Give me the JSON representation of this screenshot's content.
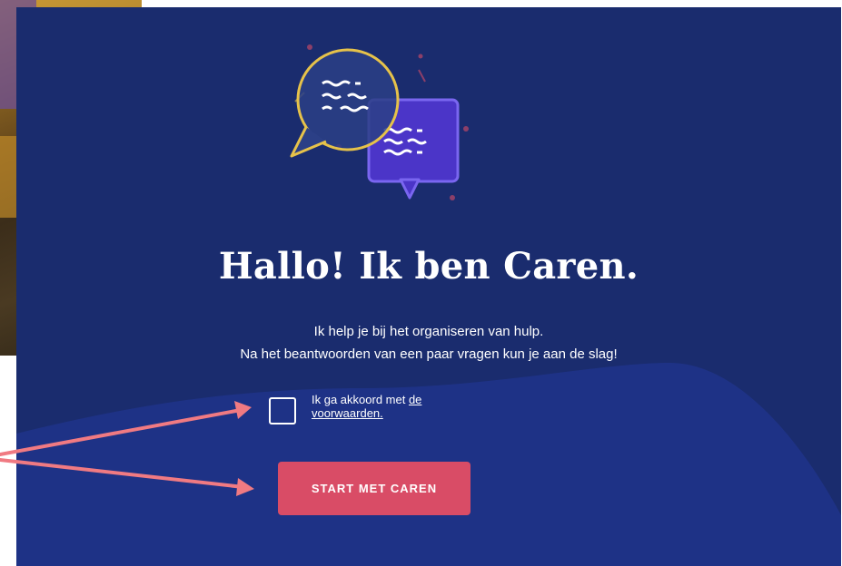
{
  "heading": "Hallo! Ik ben Caren.",
  "intro_line1": "Ik help je bij het organiseren van hulp.",
  "intro_line2": "Na het beantwoorden van een paar vragen kun je aan de slag!",
  "consent": {
    "prefix": "Ik ga akkoord met ",
    "link_part1": "de",
    "link_part2": "voorwaarden."
  },
  "start_button": "START MET CAREN",
  "colors": {
    "panel_background": "#1a2c6e",
    "button": "#d94c66",
    "annotation_arrow": "#f07a82",
    "bubble_yellow": "#e6c24a",
    "bubble_purple": "#5a3fd6"
  },
  "icons": [
    "chat-bubbles-illustration",
    "annotation-arrow"
  ]
}
